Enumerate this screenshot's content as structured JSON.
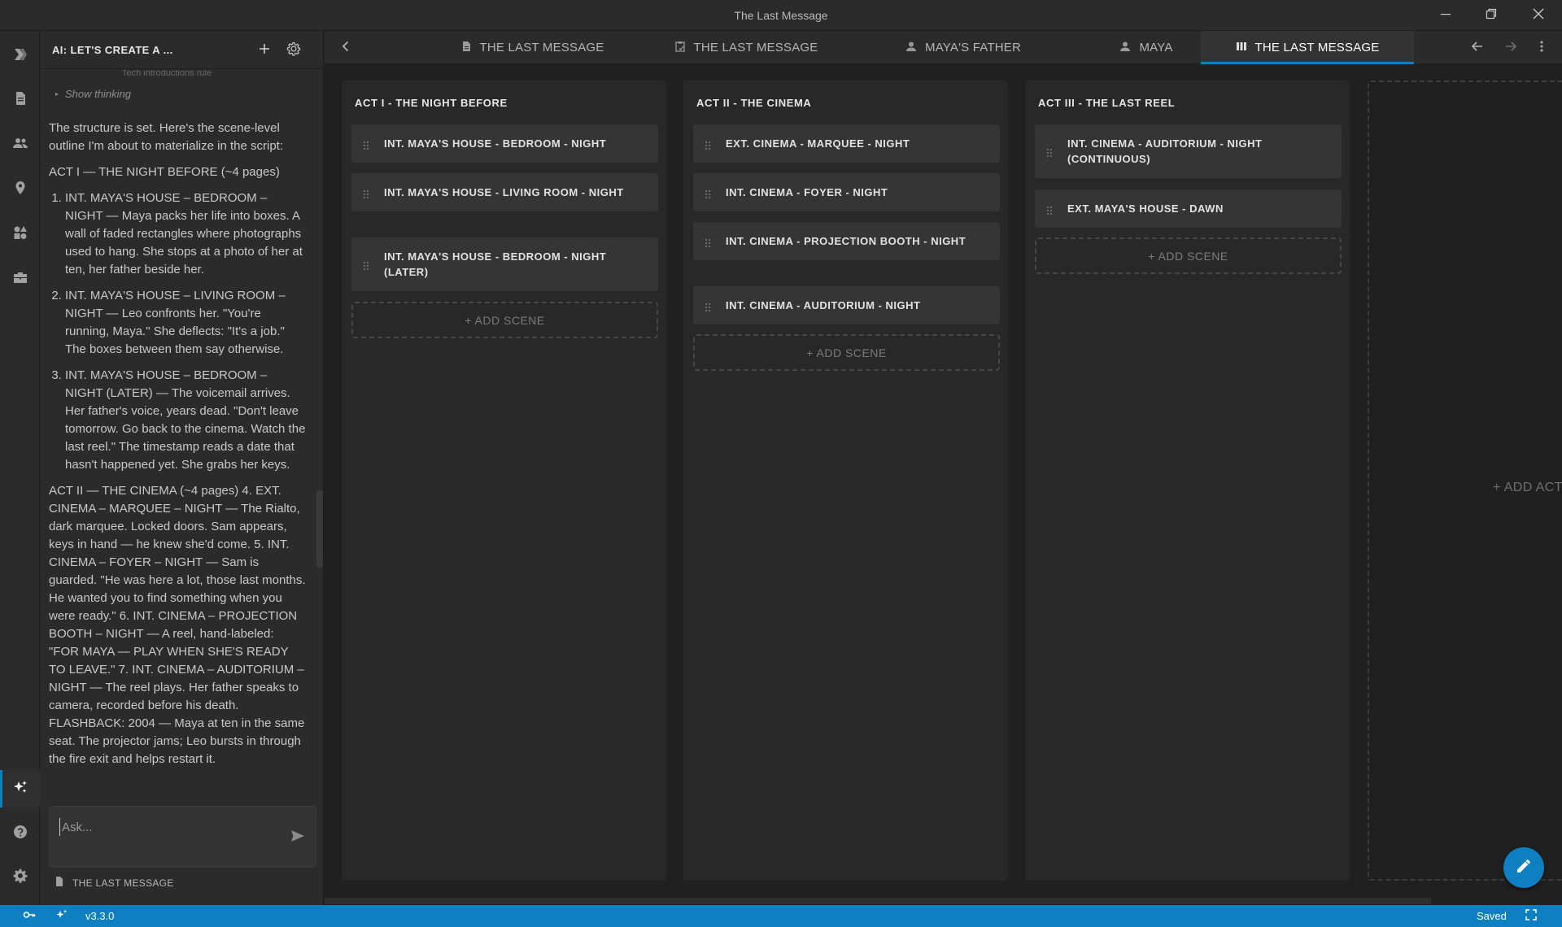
{
  "window": {
    "title": "The Last Message",
    "controls": [
      "minimize-icon",
      "restore-icon",
      "close-icon"
    ]
  },
  "activity_bar": {
    "items": [
      {
        "name": "logo",
        "icon": "logo-icon"
      },
      {
        "name": "documents",
        "icon": "document-icon"
      },
      {
        "name": "characters",
        "icon": "people-icon"
      },
      {
        "name": "locations",
        "icon": "location-icon"
      },
      {
        "name": "elements",
        "icon": "shapes-icon"
      },
      {
        "name": "toolbox",
        "icon": "toolbox-icon"
      },
      {
        "name": "ai",
        "icon": "sparkle-icon",
        "active": true
      },
      {
        "name": "help",
        "icon": "help-icon"
      },
      {
        "name": "settings",
        "icon": "gear-icon"
      }
    ]
  },
  "chat": {
    "title": "AI: LET'S CREATE A ...",
    "faded_line": "Tech introductions rule",
    "show_thinking": "Show thinking",
    "intro": "The structure is set. Here's the scene-level outline I'm about to materialize in the script:",
    "act1_heading": "ACT I — THE NIGHT BEFORE (~4 pages)",
    "act1_items": [
      "INT. MAYA'S HOUSE – BEDROOM – NIGHT — Maya packs her life into boxes. A wall of faded rectangles where photographs used to hang. She stops at a photo of her at ten, her father beside her.",
      "INT. MAYA'S HOUSE – LIVING ROOM – NIGHT — Leo confronts her. \"You're running, Maya.\" She deflects: \"It's a job.\" The boxes between them say otherwise.",
      "INT. MAYA'S HOUSE – BEDROOM – NIGHT (LATER) — The voicemail arrives. Her father's voice, years dead. \"Don't leave tomorrow. Go back to the cinema. Watch the last reel.\" The timestamp reads a date that hasn't happened yet. She grabs her keys."
    ],
    "act2_paragraph": "ACT II — THE CINEMA (~4 pages) 4. EXT. CINEMA – MARQUEE – NIGHT — The Rialto, dark marquee. Locked doors. Sam appears, keys in hand — he knew she'd come. 5. INT. CINEMA – FOYER – NIGHT — Sam is guarded. \"He was here a lot, those last months. He wanted you to find something when you were ready.\" 6. INT. CINEMA – PROJECTION BOOTH – NIGHT — A reel, hand-labeled: \"FOR MAYA — PLAY WHEN SHE'S READY TO LEAVE.\" 7. INT. CINEMA – AUDITORIUM – NIGHT — The reel plays. Her father speaks to camera, recorded before his death. FLASHBACK: 2004 — Maya at ten in the same seat. The projector jams; Leo bursts in through the fire exit and helps restart it.",
    "input_placeholder": "Ask...",
    "input_value": "",
    "context_doc": "THE LAST MESSAGE"
  },
  "tabs": [
    {
      "label": "THE LAST MESSAGE",
      "icon": "document-icon",
      "active": false
    },
    {
      "label": "THE LAST MESSAGE",
      "icon": "clipboard-icon",
      "active": false
    },
    {
      "label": "MAYA'S FATHER",
      "icon": "person-icon",
      "active": false
    },
    {
      "label": "MAYA",
      "icon": "person-icon",
      "active": false
    },
    {
      "label": "THE LAST MESSAGE",
      "icon": "columns-icon",
      "active": true
    }
  ],
  "board": {
    "acts": [
      {
        "title": "ACT I - THE NIGHT BEFORE",
        "scenes": [
          {
            "label": "INT. MAYA'S HOUSE - BEDROOM - NIGHT"
          },
          {
            "label": "INT. MAYA'S HOUSE - LIVING ROOM - NIGHT"
          },
          {
            "label": "INT. MAYA'S HOUSE - BEDROOM - NIGHT (LATER)"
          }
        ]
      },
      {
        "title": "ACT II - THE CINEMA",
        "scenes": [
          {
            "label": "EXT. CINEMA - MARQUEE - NIGHT"
          },
          {
            "label": "INT. CINEMA - FOYER - NIGHT"
          },
          {
            "label": "INT. CINEMA - PROJECTION BOOTH - NIGHT"
          },
          {
            "label": "INT. CINEMA - AUDITORIUM - NIGHT"
          }
        ]
      },
      {
        "title": "ACT III - THE LAST REEL",
        "scenes": [
          {
            "label": "INT. CINEMA - AUDITORIUM - NIGHT (CONTINUOUS)"
          },
          {
            "label": "EXT. MAYA'S HOUSE - DAWN"
          }
        ]
      }
    ],
    "add_scene_label": "+ ADD SCENE",
    "add_act_label": "+ ADD ACT"
  },
  "status_bar": {
    "version": "v3.3.0",
    "save_status": "Saved"
  },
  "colors": {
    "accent": "#0e7fc1",
    "background": "#202020",
    "panel": "#2b2b2b",
    "card": "#353535"
  }
}
